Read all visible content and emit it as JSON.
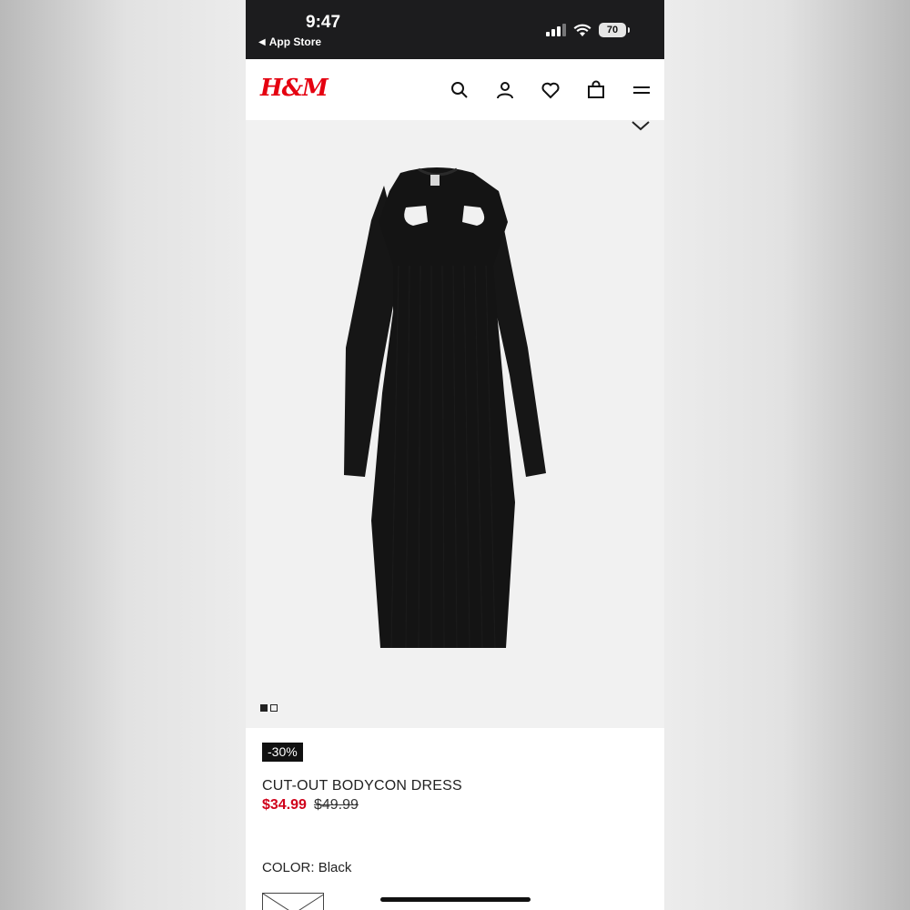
{
  "status_bar": {
    "time": "9:47",
    "back_label": "App Store",
    "battery_level": "70"
  },
  "header": {
    "logo": "H&M",
    "icons": [
      "search-icon",
      "account-icon",
      "heart-icon",
      "bag-icon",
      "menu-icon"
    ]
  },
  "gallery": {
    "image_count": 2,
    "active_index": 0
  },
  "product": {
    "discount": "-30%",
    "name": "CUT-OUT BODYCON DRESS",
    "sale_price": "$34.99",
    "original_price": "$49.99",
    "color_label": "COLOR:",
    "color_value": "Black"
  },
  "colors": {
    "brand_red": "#e50010",
    "sale_red": "#d0021b",
    "status_bar_bg": "#1c1c1e"
  }
}
